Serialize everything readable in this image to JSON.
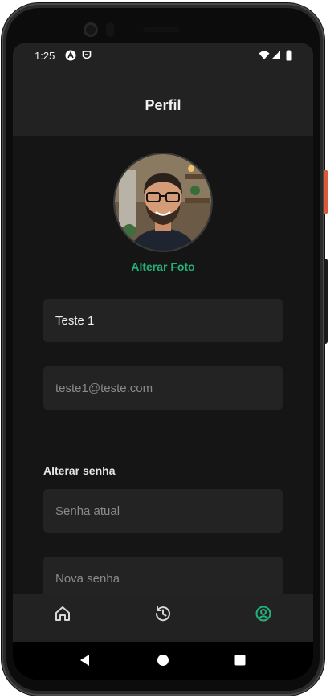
{
  "status_bar": {
    "time": "1:25",
    "icons": [
      "app-notification-icon",
      "shield-notification-icon",
      "wifi-icon",
      "signal-icon",
      "battery-icon"
    ]
  },
  "header": {
    "title": "Perfil"
  },
  "profile": {
    "change_photo_label": "Alterar Foto",
    "name_value": "Teste 1",
    "email_placeholder": "teste1@teste.com"
  },
  "password": {
    "section_label": "Alterar senha",
    "current_placeholder": "Senha atual",
    "new_placeholder": "Nova senha"
  },
  "tab_bar": {
    "items": [
      {
        "icon": "home-icon",
        "active": false
      },
      {
        "icon": "history-icon",
        "active": false
      },
      {
        "icon": "profile-icon",
        "active": true
      }
    ]
  },
  "system_nav": {
    "icons": [
      "back-icon",
      "home-circle-icon",
      "recents-icon"
    ]
  },
  "colors": {
    "accent": "#23b07a",
    "background": "#151515",
    "surface": "#232323",
    "header": "#222222"
  }
}
